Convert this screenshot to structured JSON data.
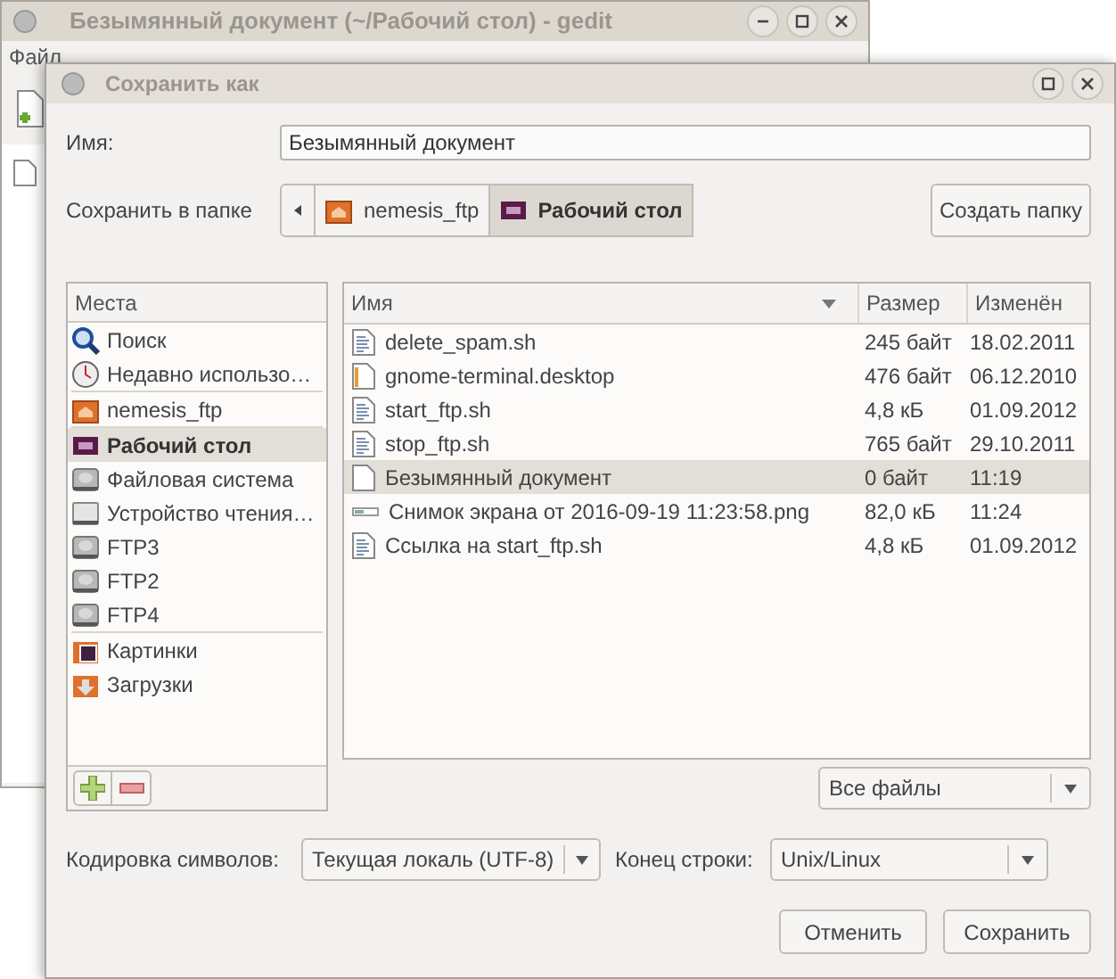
{
  "background_window": {
    "title": "Безымянный документ (~/Рабочий стол) - gedit",
    "menu": [
      "Файл"
    ]
  },
  "dialog": {
    "title": "Сохранить как",
    "name_label": "Имя:",
    "name_value": "Безымянный документ",
    "folder_label": "Сохранить в папке",
    "path": [
      {
        "label": "nemesis_ftp",
        "kind": "home",
        "selected": false
      },
      {
        "label": "Рабочий стол",
        "kind": "desktop",
        "selected": true
      }
    ],
    "create_folder": "Создать папку",
    "places": {
      "header": "Места",
      "sections": [
        [
          {
            "label": "Поиск",
            "kind": "search",
            "selected": false
          },
          {
            "label": "Недавно использо…",
            "kind": "recent",
            "selected": false
          }
        ],
        [
          {
            "label": "nemesis_ftp",
            "kind": "home",
            "selected": false
          }
        ],
        [
          {
            "label": "Рабочий стол",
            "kind": "desktop",
            "selected": true
          },
          {
            "label": "Файловая система",
            "kind": "drive",
            "selected": false
          },
          {
            "label": "Устройство чтения…",
            "kind": "optical",
            "selected": false
          },
          {
            "label": "FTP3",
            "kind": "drive",
            "selected": false
          },
          {
            "label": "FTP2",
            "kind": "drive",
            "selected": false
          },
          {
            "label": "FTP4",
            "kind": "drive",
            "selected": false
          }
        ],
        [
          {
            "label": "Картинки",
            "kind": "pictures",
            "selected": false
          },
          {
            "label": "Загрузки",
            "kind": "downloads",
            "selected": false
          }
        ]
      ]
    },
    "files": {
      "columns": [
        "Имя",
        "Размер",
        "Изменён"
      ],
      "rows": [
        {
          "name": "delete_spam.sh",
          "size": "245 байт",
          "modified": "18.02.2011",
          "kind": "script",
          "selected": false
        },
        {
          "name": "gnome-terminal.desktop",
          "size": "476 байт",
          "modified": "06.12.2010",
          "kind": "launcher",
          "selected": false
        },
        {
          "name": "start_ftp.sh",
          "size": "4,8 кБ",
          "modified": "01.09.2012",
          "kind": "script",
          "selected": false
        },
        {
          "name": "stop_ftp.sh",
          "size": "765 байт",
          "modified": "29.10.2011",
          "kind": "script",
          "selected": false
        },
        {
          "name": "Безымянный документ",
          "size": "0 байт",
          "modified": "11:19",
          "kind": "text",
          "selected": true
        },
        {
          "name": "Снимок экрана от 2016-09-19 11:23:58.png",
          "size": "82,0 кБ",
          "modified": "11:24",
          "kind": "image",
          "selected": false
        },
        {
          "name": "Ссылка на start_ftp.sh",
          "size": "4,8 кБ",
          "modified": "01.09.2012",
          "kind": "script",
          "selected": false
        }
      ]
    },
    "filter": "Все файлы",
    "encoding_label": "Кодировка символов:",
    "encoding_value": "Текущая локаль (UTF-8)",
    "line_end_label": "Конец строки:",
    "line_end_value": "Unix/Linux",
    "buttons": [
      "Отменить",
      "Сохранить"
    ]
  }
}
